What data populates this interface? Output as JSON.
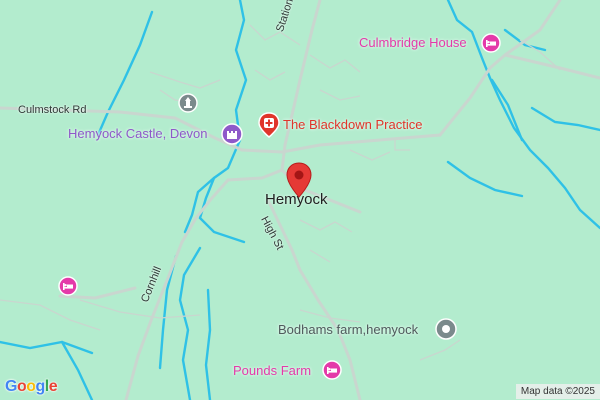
{
  "map": {
    "roads": {
      "culmstock": "Culmstock Rd",
      "station": "Station Rd",
      "high_st": "High St",
      "cornhill": "Cornhill"
    },
    "places": {
      "culmbridge": "Culmbridge House",
      "castle": "Hemyock Castle, Devon",
      "practice": "The Blackdown Practice",
      "hemyock": "Hemyock",
      "bodhams": "Bodhams farm,hemyock",
      "pounds": "Pounds Farm"
    },
    "attribution": {
      "logo": [
        "G",
        "o",
        "o",
        "g",
        "l",
        "e"
      ],
      "map_data": "Map data ©2025"
    },
    "colors": {
      "land": "#b3ecce",
      "water": "#2fc1e6",
      "road": "#c9d6cf",
      "pink_poi": "#e43aa9",
      "red_poi": "#e0352b",
      "purple_poi": "#8e59c9",
      "grey_poi": "#7b8a8c",
      "marker": "#e53935"
    },
    "icons": {
      "culmbridge": "hotel-icon",
      "castle": "castle-icon",
      "practice": "hospital-icon",
      "monument": "monument-icon",
      "bodhams": "place-dot-icon",
      "pounds": "hotel-icon",
      "hotel_west": "hotel-icon",
      "marker": "location-marker-icon"
    }
  }
}
